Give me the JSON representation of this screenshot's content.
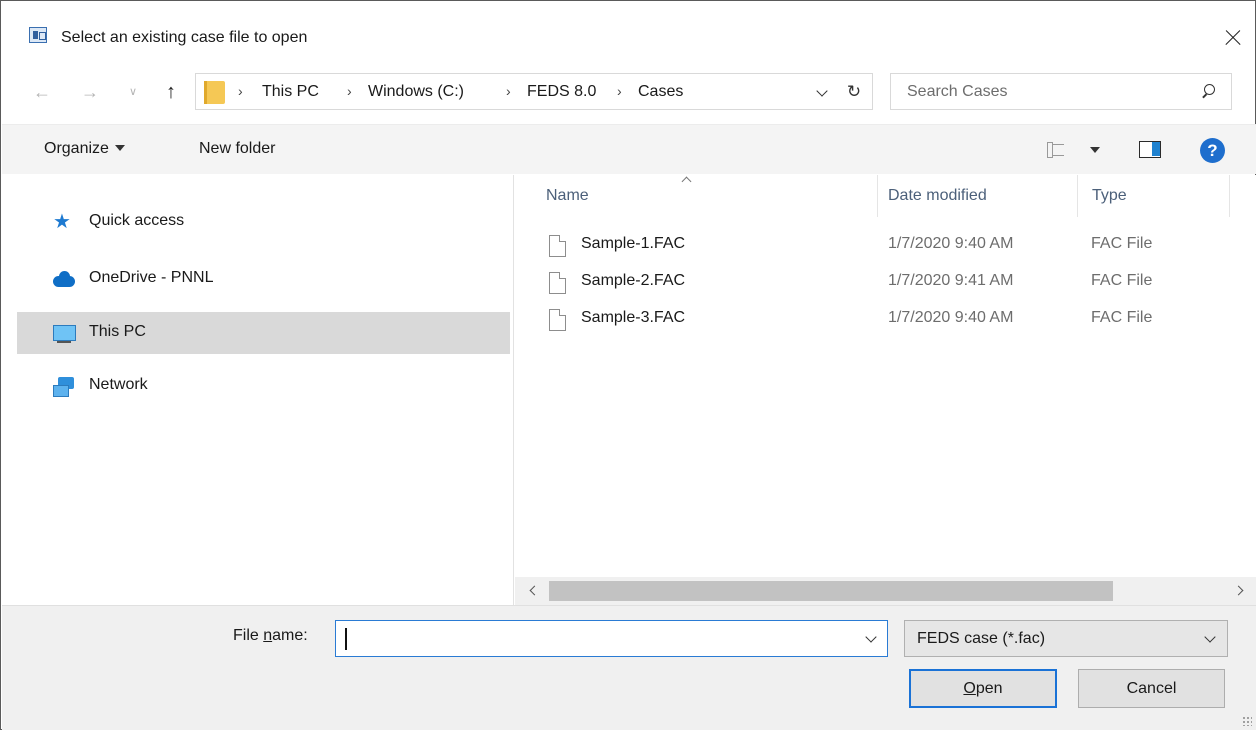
{
  "window": {
    "title": "Select an existing case file to open"
  },
  "navigation": {
    "breadcrumbs": [
      "This PC",
      "Windows (C:)",
      "FEDS 8.0",
      "Cases"
    ],
    "search_placeholder": "Search Cases"
  },
  "toolbar": {
    "organize_label": "Organize",
    "new_folder_label": "New folder",
    "help_symbol": "?"
  },
  "sidebar": {
    "items": [
      {
        "label": "Quick access",
        "icon": "star-icon",
        "selected": false
      },
      {
        "label": "OneDrive - PNNL",
        "icon": "cloud-icon",
        "selected": false
      },
      {
        "label": "This PC",
        "icon": "computer-icon",
        "selected": true
      },
      {
        "label": "Network",
        "icon": "network-icon",
        "selected": false
      }
    ]
  },
  "file_list": {
    "columns": [
      "Name",
      "Date modified",
      "Type"
    ],
    "rows": [
      {
        "name": "Sample-1.FAC",
        "date": "1/7/2020 9:40 AM",
        "type": "FAC File"
      },
      {
        "name": "Sample-2.FAC",
        "date": "1/7/2020 9:41 AM",
        "type": "FAC File"
      },
      {
        "name": "Sample-3.FAC",
        "date": "1/7/2020 9:40 AM",
        "type": "FAC File"
      }
    ]
  },
  "bottom": {
    "file_name_label_prefix": "File ",
    "file_name_label_mnemonic": "n",
    "file_name_label_suffix": "ame:",
    "file_name_value": "",
    "file_type_filter": "FEDS case (*.fac)",
    "open_mnemonic": "O",
    "open_rest": "pen",
    "cancel_label": "Cancel"
  },
  "colors": {
    "accent_blue": "#1a72d6",
    "selected_row": "#d9d9d9",
    "folder_yellow": "#f5c855"
  }
}
